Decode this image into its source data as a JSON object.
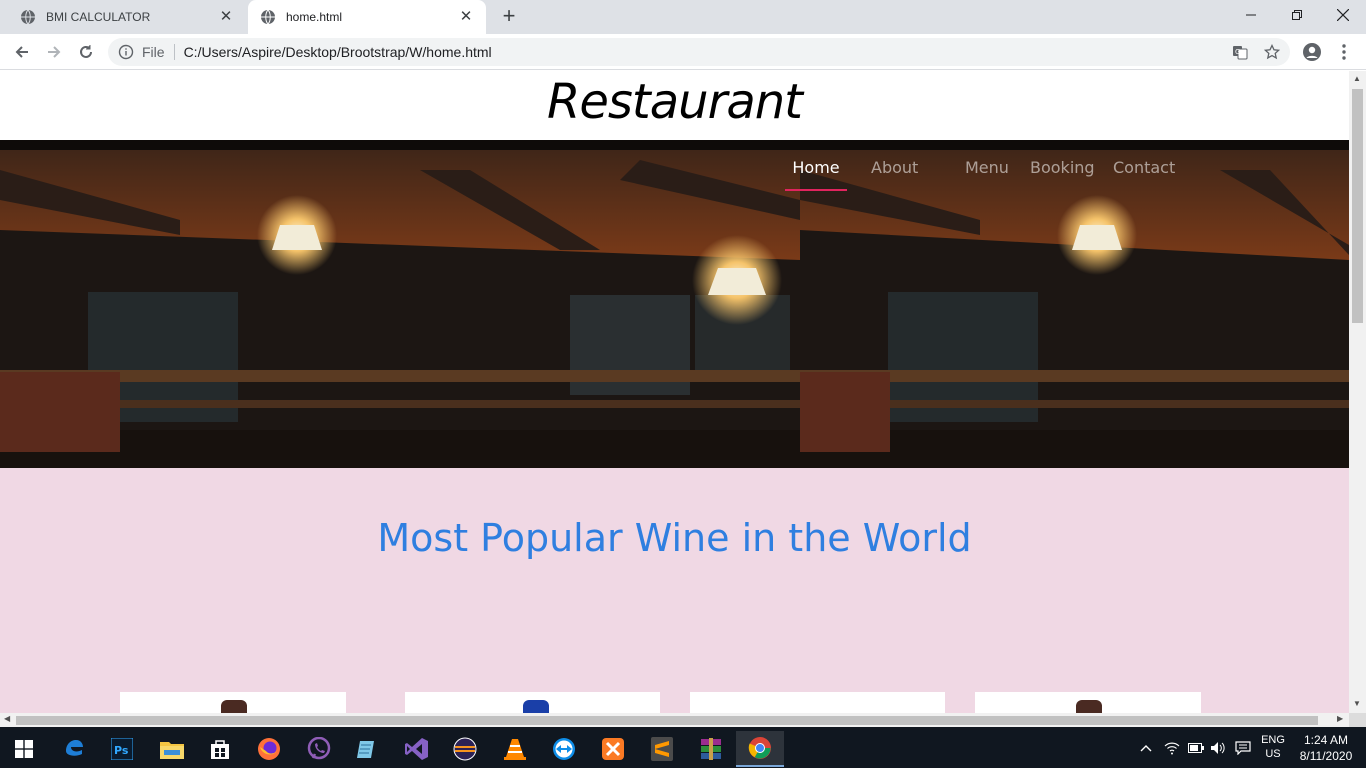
{
  "browser": {
    "tabs": [
      {
        "title": "BMI CALCULATOR",
        "icon": "globe-icon"
      },
      {
        "title": "home.html",
        "icon": "globe-icon"
      }
    ],
    "address": {
      "scheme_label": "File",
      "url": "C:/Users/Aspire/Desktop/Brootstrap/W/home.html"
    }
  },
  "page": {
    "site_title": "Restaurant",
    "nav": [
      {
        "label": "Home",
        "active": true
      },
      {
        "label": "About",
        "active": false
      },
      {
        "label": "Menu",
        "active": false
      },
      {
        "label": "Booking",
        "active": false
      },
      {
        "label": "Contact",
        "active": false
      }
    ],
    "hero_image": "bar-interior-photo",
    "section": {
      "heading": "Most Popular Wine in the World",
      "background": "#f0d8e4",
      "heading_color": "#2f7fe0"
    },
    "nav_active_color": "#e0245e"
  },
  "taskbar": {
    "apps": [
      "windows-start-icon",
      "edge-icon",
      "photoshop-icon",
      "file-explorer-icon",
      "store-icon",
      "firefox-icon",
      "viber-icon",
      "notepad-icon",
      "visual-studio-icon",
      "eclipse-icon",
      "vlc-icon",
      "teamviewer-icon",
      "xampp-icon",
      "sublime-text-icon",
      "winrar-icon",
      "chrome-icon"
    ],
    "language": {
      "line1": "ENG",
      "line2": "US"
    },
    "clock": {
      "time": "1:24 AM",
      "date": "8/11/2020"
    }
  }
}
